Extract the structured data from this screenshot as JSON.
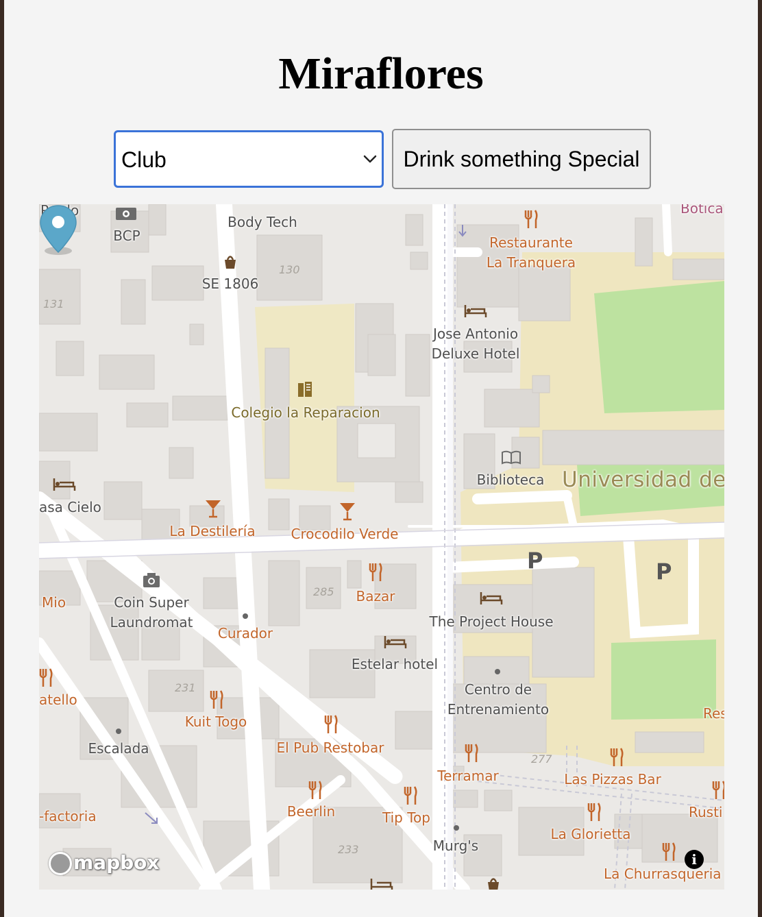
{
  "page": {
    "title": "Miraflores"
  },
  "controls": {
    "category_select": {
      "value": "Club"
    },
    "special_button_label": "Drink something Special"
  },
  "map": {
    "attribution_logo": "mapbox",
    "info_icon_glyph": "i",
    "marker": {
      "icon": "map-marker-icon",
      "color": "#5ba7c9"
    },
    "labels": {
      "pardo": "Pardo",
      "bcp": "BCP",
      "body_tech": "Body Tech",
      "se_1806": "SE 1806",
      "n130": "130",
      "n131": "131",
      "botica": "Botica",
      "restaurante_1": "Restaurante",
      "restaurante_2": "La Tranquera",
      "jose_1": "Jose Antonio",
      "jose_2": "Deluxe Hotel",
      "colegio": "Colegio la Reparacion",
      "biblioteca": "Biblioteca",
      "universidad": "Universidad de",
      "casa_cielo": "asa Cielo",
      "destileria": "La Destilería",
      "crocodilo": "Crocodilo Verde",
      "parking_1": "P",
      "parking_2": "P",
      "mio": "Mio",
      "coin_1": "Coin Super",
      "coin_2": "Laundromat",
      "curador": "Curador",
      "n285": "285",
      "bazar": "Bazar",
      "project_house": "The Project House",
      "estelar": "Estelar hotel",
      "atello": "atello",
      "n231": "231",
      "kuit_togo": "Kuit Togo",
      "centro_1": "Centro de",
      "centro_2": "Entrenamiento",
      "res": "Res",
      "escalada": "Escalada",
      "el_pub": "El Pub Restobar",
      "terramar": "Terramar",
      "n277": "277",
      "las_pizzas": "Las Pizzas Bar",
      "factoria": "-factoria",
      "beerlin": "Beerlin",
      "tip_top": "Tip Top",
      "la_glorietta": "La Glorietta",
      "rusti": "Rusti",
      "n233": "233",
      "murgs": "Murg's",
      "la_churrasqueria": "La Churrasqueria"
    }
  },
  "colors": {
    "select_focus_border": "#3b73d8",
    "poi_food": "#c2652a",
    "park_green": "#bde2a0",
    "school_yellow": "#efe6c0"
  }
}
